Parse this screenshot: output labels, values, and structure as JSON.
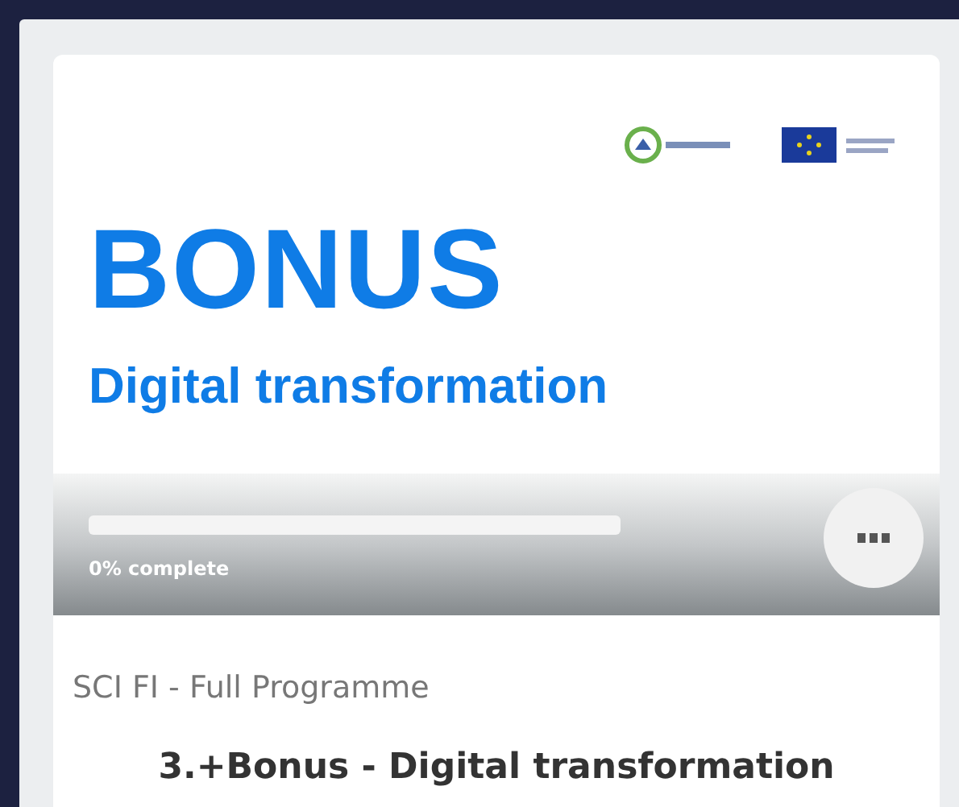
{
  "course_card": {
    "banner": {
      "heading": "BONUS",
      "subheading": "Digital transformation"
    },
    "progress": {
      "level": 0,
      "reading": "0% complete"
    },
    "category": "SCI FI - Full Programme",
    "title": "3.+Bonus - Digital transformation"
  }
}
